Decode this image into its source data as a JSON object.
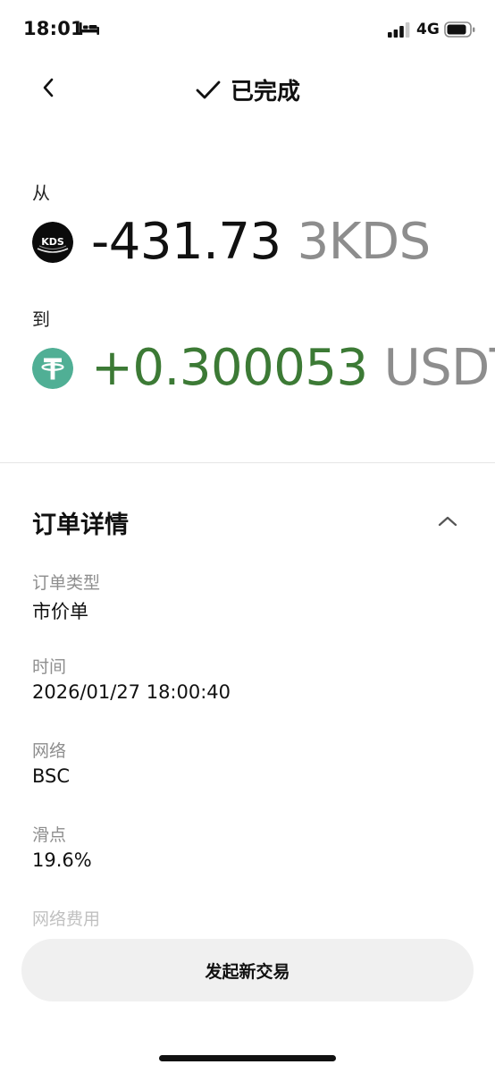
{
  "status_bar": {
    "time": "18:01",
    "network": "4G",
    "icons": [
      "sleep-bed-icon",
      "cellular-signal-icon",
      "battery-icon"
    ]
  },
  "nav": {
    "title": "已完成",
    "icons": [
      "chevron-left-icon",
      "checkmark-icon"
    ]
  },
  "swap": {
    "from_label": "从",
    "from_amount": "-431.73",
    "from_symbol": "3KDS",
    "from_icon_text": "KDS",
    "to_label": "到",
    "to_amount": "+0.300053",
    "to_symbol": "USDT",
    "to_icon_text": "T",
    "colors": {
      "positive": "#3c7a35",
      "symbol_gray": "#8d8d8d",
      "usdt_green": "#50af95"
    }
  },
  "details": {
    "title": "订单详情",
    "items": [
      {
        "label": "订单类型",
        "value": "市价单"
      },
      {
        "label": "时间",
        "value": "2026/01/27 18:00:40"
      },
      {
        "label": "网络",
        "value": "BSC"
      },
      {
        "label": "滑点",
        "value": "19.6%"
      },
      {
        "label": "网络费用",
        "value": ""
      }
    ]
  },
  "actions": {
    "new_trade": "发起新交易"
  }
}
